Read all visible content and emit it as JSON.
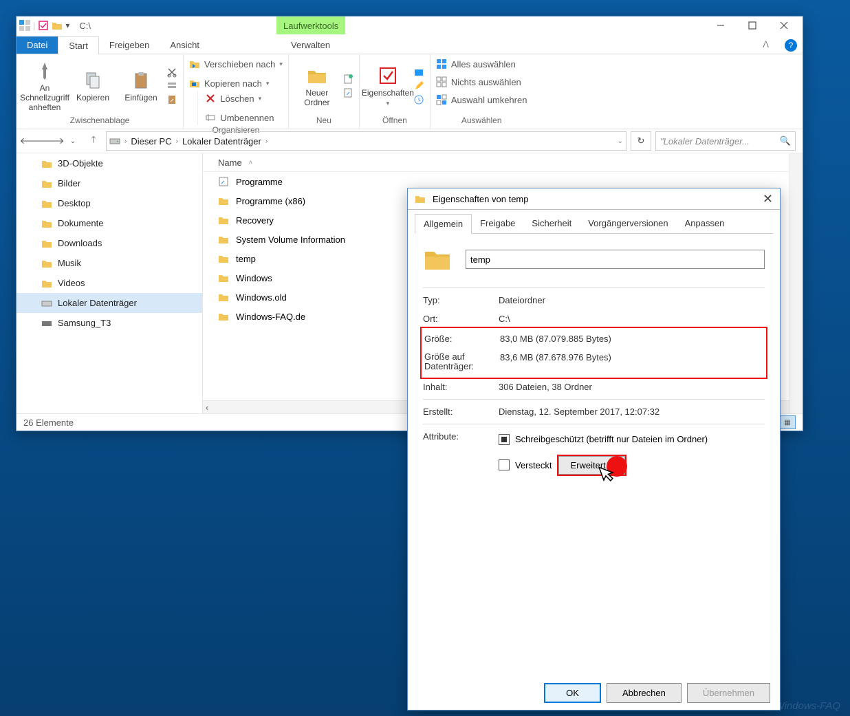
{
  "titlebar": {
    "path": "C:\\",
    "drivetools": "Laufwerktools"
  },
  "ribbontabs": {
    "file": "Datei",
    "start": "Start",
    "share": "Freigeben",
    "view": "Ansicht",
    "manage": "Verwalten"
  },
  "ribbon": {
    "pin": "An Schnellzugriff anheften",
    "copy": "Kopieren",
    "paste": "Einfügen",
    "moveto": "Verschieben nach",
    "copyto": "Kopieren nach",
    "delete": "Löschen",
    "rename": "Umbenennen",
    "newfolder": "Neuer Ordner",
    "properties": "Eigenschaften",
    "selall": "Alles auswählen",
    "selnone": "Nichts auswählen",
    "selinv": "Auswahl umkehren",
    "g_clipboard": "Zwischenablage",
    "g_organize": "Organisieren",
    "g_new": "Neu",
    "g_open": "Öffnen",
    "g_select": "Auswählen"
  },
  "breadcrumb": {
    "pc": "Dieser PC",
    "drive": "Lokaler Datenträger"
  },
  "search": {
    "placeholder": "\"Lokaler Datenträger..."
  },
  "tree": [
    "3D-Objekte",
    "Bilder",
    "Desktop",
    "Dokumente",
    "Downloads",
    "Musik",
    "Videos",
    "Lokaler Datenträger",
    "Samsung_T3"
  ],
  "list": {
    "name_col": "Name",
    "items": [
      "Programme",
      "Programme (x86)",
      "Recovery",
      "System Volume Information",
      "temp",
      "Windows",
      "Windows.old",
      "Windows-FAQ.de"
    ]
  },
  "status": {
    "count": "26 Elemente"
  },
  "props": {
    "title": "Eigenschaften von temp",
    "tabs": [
      "Allgemein",
      "Freigabe",
      "Sicherheit",
      "Vorgängerversionen",
      "Anpassen"
    ],
    "name": "temp",
    "rows": {
      "typ_k": "Typ:",
      "typ_v": "Dateiordner",
      "ort_k": "Ort:",
      "ort_v": "C:\\",
      "size_k": "Größe:",
      "size_v": "83,0 MB (87.079.885 Bytes)",
      "disk_k": "Größe auf Datenträger:",
      "disk_v": "83,6 MB (87.678.976 Bytes)",
      "cont_k": "Inhalt:",
      "cont_v": "306 Dateien, 38 Ordner",
      "erst_k": "Erstellt:",
      "erst_v": "Dienstag, 12. September 2017, 12:07:32",
      "attr_k": "Attribute:",
      "ro": "Schreibgeschützt (betrifft nur Dateien im Ordner)",
      "hidden": "Versteckt",
      "adv": "Erweitert..."
    },
    "btns": {
      "ok": "OK",
      "cancel": "Abbrechen",
      "apply": "Übernehmen"
    }
  }
}
